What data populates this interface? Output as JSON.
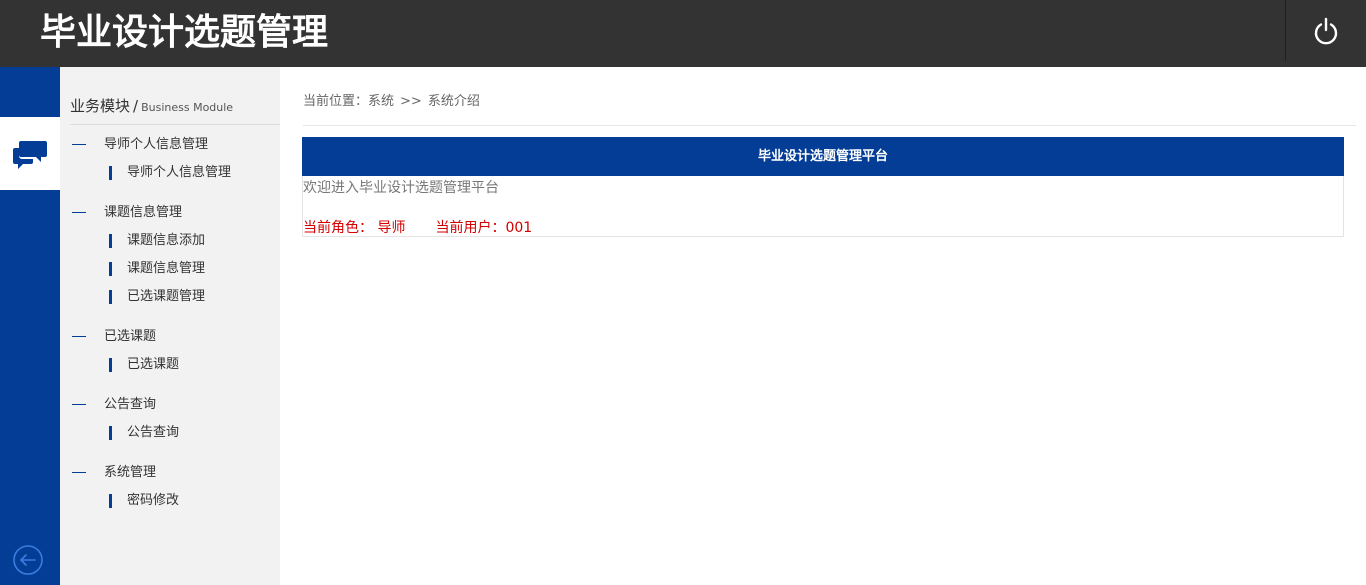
{
  "header": {
    "title": "毕业设计选题管理",
    "power_icon": "power-icon"
  },
  "iconbar": {
    "active_icon": "chat-bubbles-icon",
    "back_icon": "arrow-left-circle-icon",
    "accent_color": "#033d96"
  },
  "sidebar": {
    "module_title": "业务模块",
    "module_separator": "/",
    "module_subtitle": "Business Module",
    "groups": [
      {
        "label": "导师个人信息管理",
        "items": [
          "导师个人信息管理"
        ]
      },
      {
        "label": "课题信息管理",
        "items": [
          "课题信息添加",
          "课题信息管理",
          "已选课题管理"
        ]
      },
      {
        "label": "已选课题",
        "items": [
          "已选课题"
        ]
      },
      {
        "label": "公告查询",
        "items": [
          "公告查询"
        ]
      },
      {
        "label": "系统管理",
        "items": [
          "密码修改"
        ]
      }
    ]
  },
  "main": {
    "breadcrumb": {
      "prefix": "当前位置：系统",
      "separator": ">>",
      "current": "系统介绍"
    },
    "panel": {
      "header": "毕业设计选题管理平台",
      "welcome": "欢迎进入毕业设计选题管理平台",
      "role_label": "当前角色：",
      "role_value": "导师",
      "user_label": "当前用户：",
      "user_value": "001"
    }
  }
}
